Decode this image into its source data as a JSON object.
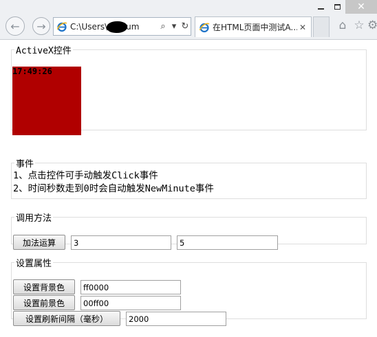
{
  "window": {
    "minimize_glyph": "",
    "close_glyph": "✕"
  },
  "toolbar": {
    "back_glyph": "←",
    "forward_glyph": "→",
    "address": "C:\\Users\\     Docum",
    "search_glyph": "⌕",
    "refresh_glyph": "↻",
    "home_glyph": "⌂",
    "star_glyph": "☆",
    "gear_glyph": "⚙"
  },
  "tab": {
    "title": "在HTML页面中测试A...",
    "close_glyph": "✕"
  },
  "activex": {
    "legend": "ActiveX控件",
    "clock": "17:49:26",
    "control_color": "#b00000"
  },
  "events": {
    "legend": "事件",
    "lines": [
      "1、点击控件可手动触发Click事件",
      "2、时间秒数走到0时会自动触发NewMinute事件"
    ]
  },
  "methods": {
    "legend": "调用方法",
    "add_button": "加法运算",
    "operand1": "3",
    "operand2": "5"
  },
  "properties": {
    "legend": "设置属性",
    "bgcolor_button": "设置背景色",
    "bgcolor_value": "ff0000",
    "fgcolor_button": "设置前景色",
    "fgcolor_value": "00ff00",
    "interval_button": "设置刷新间隔（毫秒）",
    "interval_value": "2000"
  }
}
